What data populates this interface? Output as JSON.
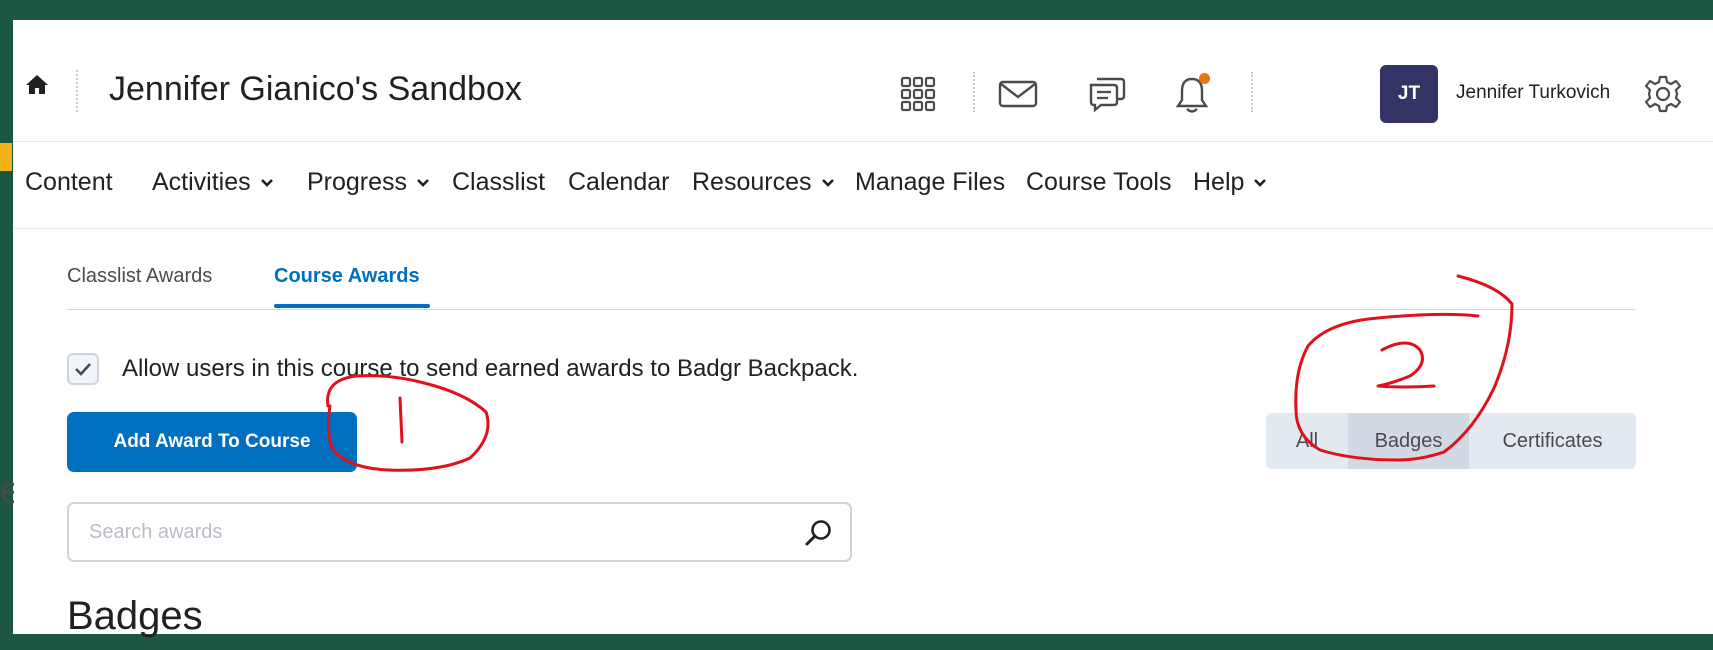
{
  "header": {
    "course_title": "Jennifer Gianico's Sandbox",
    "user_initials": "JT",
    "user_name": "Jennifer Turkovich"
  },
  "nav": {
    "items": [
      {
        "label": "Content",
        "has_menu": false
      },
      {
        "label": "Activities",
        "has_menu": true
      },
      {
        "label": "Progress",
        "has_menu": true
      },
      {
        "label": "Classlist",
        "has_menu": false
      },
      {
        "label": "Calendar",
        "has_menu": false
      },
      {
        "label": "Resources",
        "has_menu": true
      },
      {
        "label": "Manage Files",
        "has_menu": false
      },
      {
        "label": "Course Tools",
        "has_menu": false
      },
      {
        "label": "Help",
        "has_menu": true
      }
    ]
  },
  "tabs": [
    {
      "label": "Classlist Awards",
      "active": false
    },
    {
      "label": "Course Awards",
      "active": true
    }
  ],
  "badgr_option": {
    "label": "Allow users in this course to send earned awards to Badgr Backpack.",
    "checked": true
  },
  "add_award_button": "Add Award To Course",
  "filter": {
    "options": [
      "All",
      "Badges",
      "Certificates"
    ],
    "selected": "Badges"
  },
  "search": {
    "placeholder": "Search awards",
    "value": ""
  },
  "section_heading": "Badges",
  "annotations": [
    "1",
    "2"
  ],
  "colors": {
    "frame": "#1b5742",
    "primary": "#006fbf",
    "avatar": "#333366",
    "notification_dot": "#e87511",
    "annotation": "#e0101c"
  }
}
